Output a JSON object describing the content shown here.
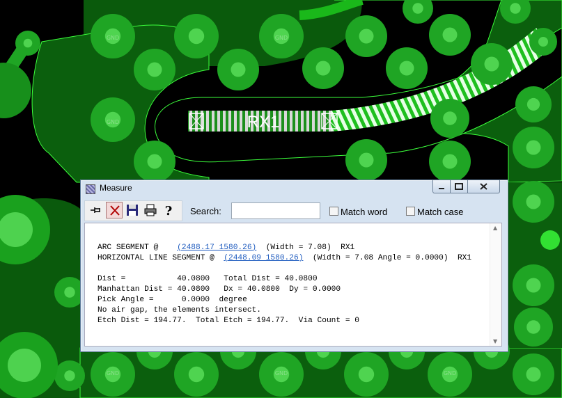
{
  "pcb": {
    "net_label": "RX1",
    "gnd_label": "GND",
    "colors": {
      "board": "#000000",
      "copper": "#0f6e12",
      "pad": "#1fa524",
      "pad_hole": "#45d04a",
      "outline": "#3cff3c",
      "trace": "#1ab81a"
    }
  },
  "window": {
    "title": "Measure",
    "icon": "measure-app-icon",
    "controls": {
      "minimize": "minimize-icon",
      "maximize": "maximize-icon",
      "close": "close-icon"
    }
  },
  "toolbar": {
    "buttons": [
      {
        "name": "pin-button",
        "icon": "pin-icon"
      },
      {
        "name": "clear-button",
        "icon": "x-icon"
      },
      {
        "name": "save-button",
        "icon": "floppy-disk-icon"
      },
      {
        "name": "print-button",
        "icon": "printer-icon"
      },
      {
        "name": "help-button",
        "icon": "question-mark-icon"
      }
    ]
  },
  "search": {
    "label": "Search:",
    "value": "",
    "placeholder": ""
  },
  "options": {
    "match_word": "Match word",
    "match_case": "Match case"
  },
  "report": {
    "arc_prefix": "ARC SEGMENT @    ",
    "arc_coords": "(2488.17 1580.26)",
    "arc_suffix": "  (Width = 7.08)  RX1",
    "line_prefix": "HORIZONTAL LINE SEGMENT @  ",
    "line_coords": "(2448.09 1580.26)",
    "line_suffix": "  (Width = 7.08 Angle = 0.0000)  RX1",
    "dist": "Dist =           40.0800   Total Dist = 40.0800",
    "manhattan": "Manhattan Dist = 40.0800   Dx = 40.0800  Dy = 0.0000",
    "pick_angle": "Pick Angle =      0.0000  degree",
    "air_gap": "No air gap, the elements intersect.",
    "etch": "Etch Dist = 194.77.  Total Etch = 194.77.  Via Count = 0"
  }
}
